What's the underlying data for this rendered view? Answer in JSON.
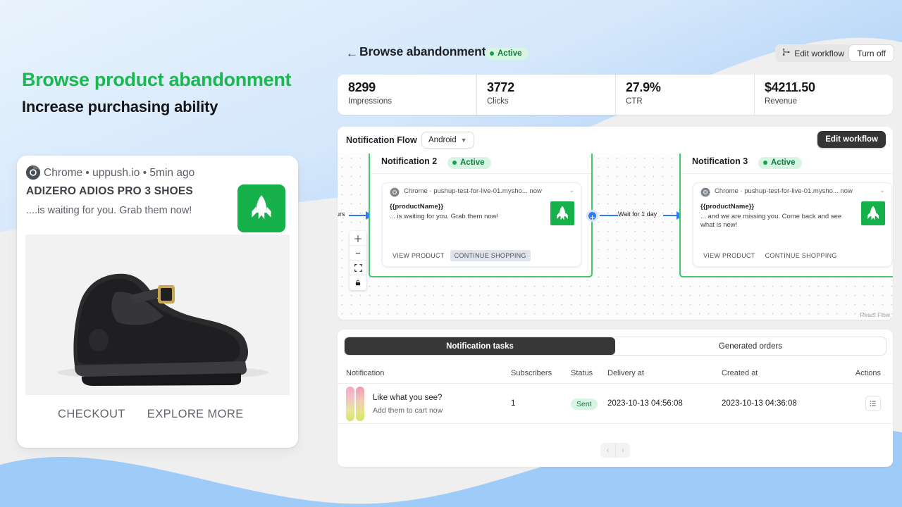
{
  "promo": {
    "headline": "Browse product abandonment",
    "subhead": "Increase purchasing ability",
    "push_preview": {
      "meta": "Chrome • uppush.io • 5min ago",
      "title": "ADIZERO ADIOS PRO 3 SHOES",
      "body": "....is waiting for you. Grab them now!",
      "actions": [
        "CHECKOUT",
        "EXPLORE MORE"
      ]
    }
  },
  "app": {
    "topbar": {
      "back": "←",
      "title": "Browse abandonment",
      "status": "Active",
      "edit_workflow": "Edit workflow",
      "turn_off": "Turn off"
    },
    "stats": [
      {
        "value": "8299",
        "label": "Impressions"
      },
      {
        "value": "3772",
        "label": "Clicks"
      },
      {
        "value": "27.9%",
        "label": "CTR"
      },
      {
        "value": "$4211.50",
        "label": "Revenue"
      }
    ],
    "flow": {
      "title": "Notification Flow",
      "platform": "Android",
      "edit_workflow": "Edit workflow",
      "attribution": "React Flow",
      "incoming_edge_label": "urs",
      "delay_edge_label": "Wait for 1 day",
      "controls": [
        "zoom-in",
        "zoom-out",
        "fit-view",
        "lock"
      ],
      "nodes": [
        {
          "name": "Notification 2",
          "status": "Active",
          "card": {
            "meta": "Chrome  ·  pushup-test-for-live-01.mysho...  now",
            "title": "{{productName}}",
            "body": "... is waiting for you. Grab them now!",
            "actions": [
              "VIEW PRODUCT",
              "CONTINUE SHOPPING"
            ],
            "highlighted_action": "CONTINUE SHOPPING"
          }
        },
        {
          "name": "Notification 3",
          "status": "Active",
          "card": {
            "meta": "Chrome  ·  pushup-test-for-live-01.mysho...  now",
            "title": "{{productName}}",
            "body": "... and we are missing you. Come back and see what is new!",
            "actions": [
              "VIEW PRODUCT",
              "CONTINUE SHOPPING"
            ],
            "highlighted_action": ""
          }
        }
      ]
    },
    "table": {
      "tabs": [
        {
          "label": "Notification tasks",
          "active": true
        },
        {
          "label": "Generated orders",
          "active": false
        }
      ],
      "columns": [
        "Notification",
        "Subscribers",
        "Status",
        "Delivery at",
        "Created at",
        "Actions"
      ],
      "rows": [
        {
          "title": "Like what you see?",
          "subtitle": "Add them to cart now",
          "subscribers": "1",
          "status": "Sent",
          "delivery_at": "2023-10-13 04:56:08",
          "created_at": "2023-10-13 04:36:08"
        }
      ],
      "pagination": {
        "prev": "‹",
        "next": "›"
      }
    }
  },
  "colors": {
    "brand_green": "#1ab84f",
    "accent_blue": "#2f7af5",
    "wave_blue": "#9ecbf7",
    "node_border": "#3fca6b",
    "page_bg": "#efefef"
  }
}
